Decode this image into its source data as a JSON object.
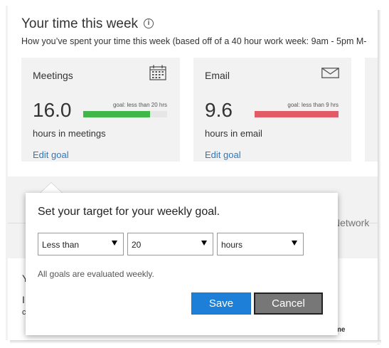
{
  "header": {
    "title": "Your time this week",
    "subtitle": "How you’ve spent your time this week (based off of a 40 hour work week: 9am - 5pm M-"
  },
  "cards": [
    {
      "title": "Meetings",
      "icon": "calendar-icon",
      "value": "16.0",
      "goal_label": "goal: less than 20 hrs",
      "goal_progress": 0.8,
      "goal_color": "#41b649",
      "unit_label": "hours in meetings",
      "link": "Edit goal"
    },
    {
      "title": "Email",
      "icon": "envelope-icon",
      "value": "9.6",
      "goal_label": "goal: less than 9 hrs",
      "goal_progress": 1.0,
      "goal_color": "#e25c67",
      "unit_label": "hours in email",
      "link": "Edit goal"
    }
  ],
  "background": {
    "network_tab": "Network",
    "fragment_1": "Y",
    "fragment_2": "I",
    "fragment_3": "c",
    "fragment_4": "me"
  },
  "popover": {
    "heading": "Set your target for your weekly goal.",
    "operator": {
      "selected": "Less than"
    },
    "value": {
      "selected": "20"
    },
    "unit": {
      "selected": "hours"
    },
    "note": "All goals are evaluated weekly.",
    "save_label": "Save",
    "cancel_label": "Cancel"
  },
  "colors": {
    "link": "#2b78c5",
    "save_button": "#1e7fd8",
    "cancel_button": "#777777"
  }
}
